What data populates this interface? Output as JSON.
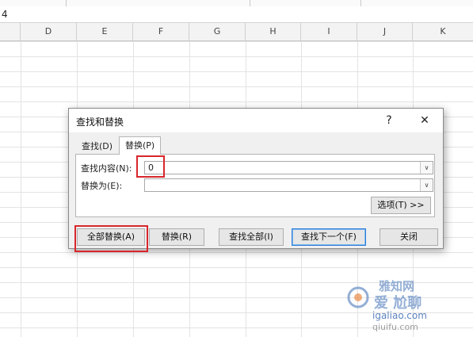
{
  "formula_bar": {
    "cell_text": "4"
  },
  "columns": [
    "D",
    "E",
    "F",
    "G",
    "H",
    "I",
    "J",
    "K"
  ],
  "dialog": {
    "title": "查找和替换",
    "help_label": "?",
    "close_label": "✕",
    "tabs": {
      "find": "查找(D)",
      "replace": "替换(P)"
    },
    "find_label": "查找内容(N):",
    "find_value": "0",
    "replace_label": "替换为(E):",
    "replace_value": "",
    "options_label": "选项(T) >>",
    "buttons": {
      "replace_all": "全部替换(A)",
      "replace": "替换(R)",
      "find_all": "查找全部(I)",
      "find_next": "查找下一个(F)",
      "close": "关闭"
    }
  },
  "watermark": {
    "line1": "雅知网",
    "line2": "爱 尬聊",
    "line3": "igaliao.com",
    "line4": "qiuifu.com"
  }
}
